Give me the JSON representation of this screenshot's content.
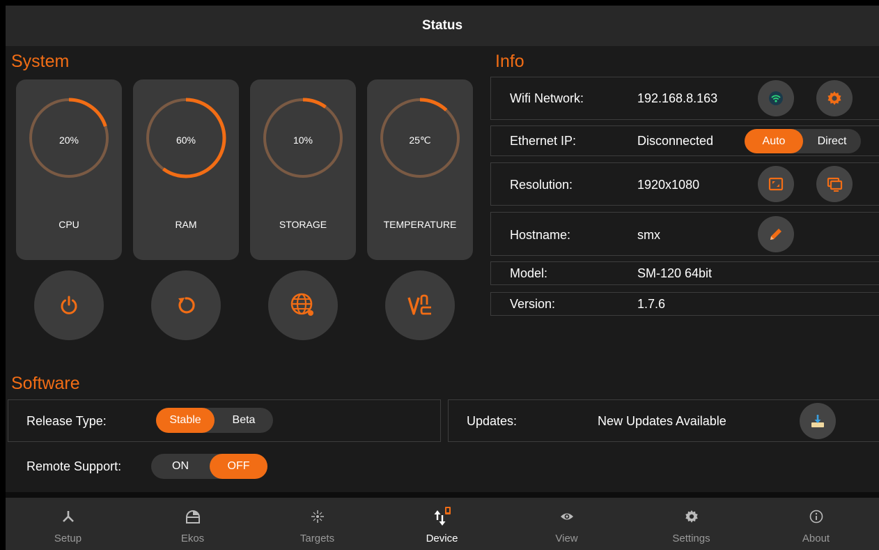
{
  "title": "Status",
  "colors": {
    "accent": "#f26d15",
    "card": "#3a3a3a",
    "track": "#7a5a44"
  },
  "system": {
    "title": "System",
    "gauges": [
      {
        "value": 20,
        "display": "20%",
        "label": "CPU"
      },
      {
        "value": 60,
        "display": "60%",
        "label": "RAM"
      },
      {
        "value": 10,
        "display": "10%",
        "label": "STORAGE"
      },
      {
        "value": 12,
        "display": "25℃",
        "label": "TEMPERATURE"
      }
    ],
    "actions": [
      "power-icon",
      "restart-icon",
      "globe-icon",
      "vnc-icon"
    ]
  },
  "info": {
    "title": "Info",
    "wifi_label": "Wifi Network:",
    "wifi_value": "192.168.8.163",
    "ethernet_label": "Ethernet IP:",
    "ethernet_value": "Disconnected",
    "ethernet_mode": {
      "options": [
        "Auto",
        "Direct"
      ],
      "selected": "Auto"
    },
    "resolution_label": "Resolution:",
    "resolution_value": "1920x1080",
    "hostname_label": "Hostname:",
    "hostname_value": "smx",
    "model_label": "Model:",
    "model_value": "SM-120 64bit",
    "version_label": "Version:",
    "version_value": "1.7.6"
  },
  "software": {
    "title": "Software",
    "release_label": "Release Type:",
    "release_options": [
      "Stable",
      "Beta"
    ],
    "release_selected": "Stable",
    "remote_label": "Remote Support:",
    "remote_options": [
      "ON",
      "OFF"
    ],
    "remote_selected": "OFF",
    "updates_label": "Updates:",
    "updates_status": "New Updates Available"
  },
  "nav": [
    {
      "label": "Setup",
      "icon": "setup-icon"
    },
    {
      "label": "Ekos",
      "icon": "ekos-icon"
    },
    {
      "label": "Targets",
      "icon": "targets-icon"
    },
    {
      "label": "Device",
      "icon": "device-icon",
      "active": true
    },
    {
      "label": "View",
      "icon": "view-icon"
    },
    {
      "label": "Settings",
      "icon": "gear-icon"
    },
    {
      "label": "About",
      "icon": "info-icon"
    }
  ]
}
